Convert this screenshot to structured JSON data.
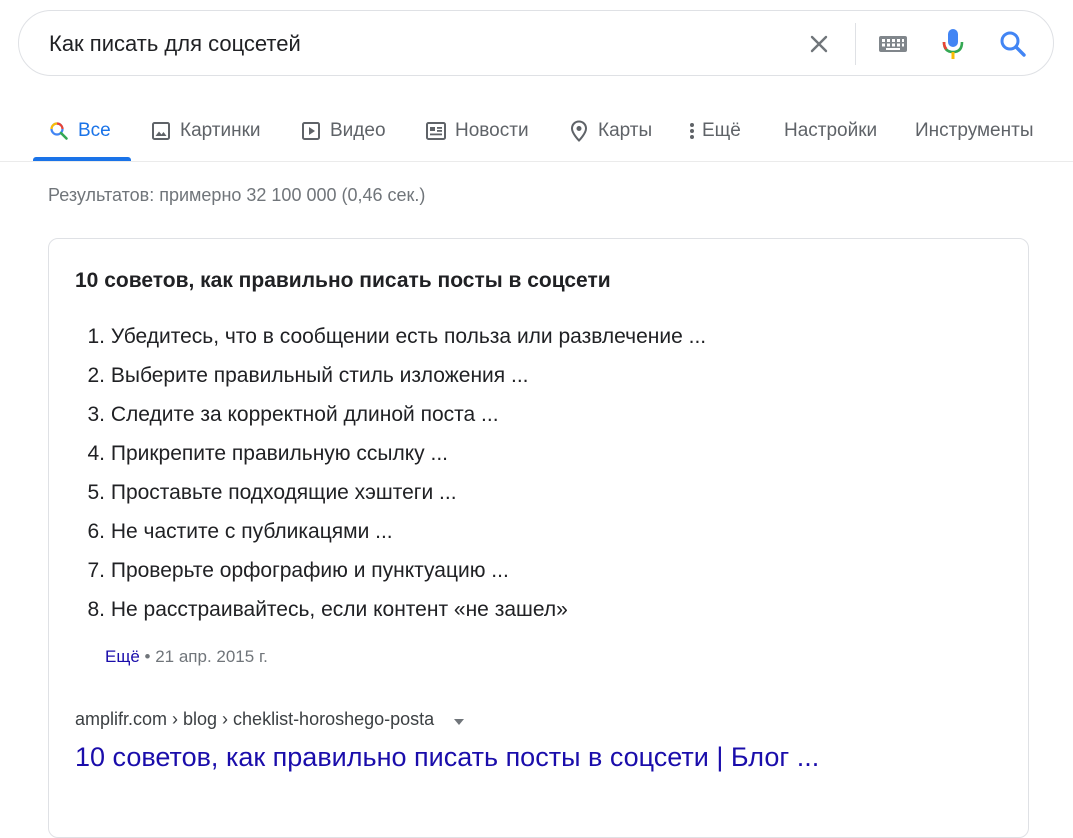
{
  "search": {
    "query": "Как писать для соцсетей",
    "icons": {
      "clear": "close-icon",
      "keyboard": "keyboard-icon",
      "mic": "microphone-icon",
      "search": "search-icon"
    }
  },
  "tabs": [
    {
      "label": "Все",
      "icon": "search-icon",
      "active": true
    },
    {
      "label": "Картинки",
      "icon": "image-icon"
    },
    {
      "label": "Видео",
      "icon": "video-icon"
    },
    {
      "label": "Новости",
      "icon": "news-icon"
    },
    {
      "label": "Карты",
      "icon": "map-pin-icon"
    },
    {
      "label": "Ещё",
      "icon": "more-vert-icon"
    },
    {
      "label": "Настройки"
    },
    {
      "label": "Инструменты"
    }
  ],
  "result_stats": "Результатов: примерно 32 100 000 (0,46 сек.)",
  "snippet": {
    "title": "10 советов, как правильно писать посты в соцсети",
    "items": [
      {
        "num": "1.",
        "text": "Убедитесь, что в сообщении есть польза или развлечение ..."
      },
      {
        "num": "2.",
        "text": "Выберите правильный стиль изложения ..."
      },
      {
        "num": "3.",
        "text": "Следите за корректной длиной поста ..."
      },
      {
        "num": "4.",
        "text": "Прикрепите правильную ссылку ..."
      },
      {
        "num": "5.",
        "text": "Проставьте подходящие хэштеги ..."
      },
      {
        "num": "6.",
        "text": "Не частите с публикацями ..."
      },
      {
        "num": "7.",
        "text": "Проверьте орфографию и пунктуацию ..."
      },
      {
        "num": "8.",
        "text": "Не расстраивайтесь, если контент «не зашел»"
      }
    ],
    "more_label": "Ещё",
    "date": "21 апр. 2015 г.",
    "breadcrumb": "amplifr.com › blog › cheklist-horoshego-posta",
    "link_title": "10 советов, как правильно писать посты в соцсети | Блог ..."
  },
  "colors": {
    "accent": "#1a73e8",
    "link": "#1a0dab",
    "muted": "#70757a"
  }
}
